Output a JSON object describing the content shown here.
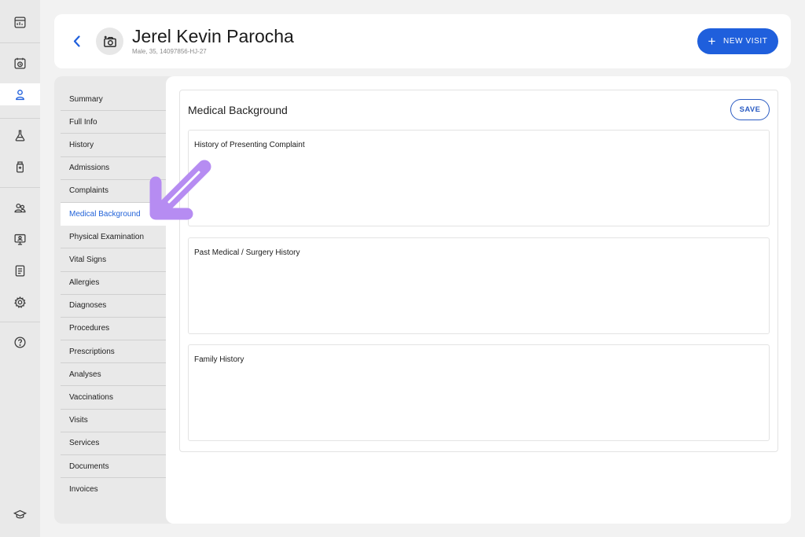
{
  "patient": {
    "name": "Jerel Kevin Parocha",
    "meta": "Male, 35, 14097856-HJ-27"
  },
  "header": {
    "new_visit_label": "NEW VISIT"
  },
  "rail": {
    "items": [
      {
        "icon": "dashboard-icon",
        "active": false
      },
      {
        "icon": "calendar-clock-icon",
        "active": false
      },
      {
        "icon": "patient-user-icon",
        "active": true
      },
      {
        "icon": "lab-flask-icon",
        "active": false
      },
      {
        "icon": "medicine-bottle-icon",
        "active": false
      },
      {
        "icon": "users-group-icon",
        "active": false
      },
      {
        "icon": "monitor-user-icon",
        "active": false
      },
      {
        "icon": "report-list-icon",
        "active": false
      },
      {
        "icon": "settings-gear-icon",
        "active": false
      },
      {
        "icon": "help-circle-icon",
        "active": false
      },
      {
        "icon": "graduation-cap-icon",
        "active": false
      }
    ],
    "accent": "#1f5fdc"
  },
  "sidenav": {
    "items": [
      "Summary",
      "Full Info",
      "History",
      "Admissions",
      "Complaints",
      "Medical Background",
      "Physical Examination",
      "Vital Signs",
      "Allergies",
      "Diagnoses",
      "Procedures",
      "Prescriptions",
      "Analyses",
      "Vaccinations",
      "Visits",
      "Services",
      "Documents",
      "Invoices"
    ],
    "active": "Medical Background"
  },
  "section": {
    "title": "Medical Background",
    "save_label": "SAVE",
    "fields": [
      {
        "label": "History of Presenting Complaint",
        "value": ""
      },
      {
        "label": "Past Medical / Surgery History",
        "value": ""
      },
      {
        "label": "Family History",
        "value": ""
      }
    ]
  },
  "annotation": {
    "arrow_color": "#b68cf2",
    "points_to": "Medical Background"
  },
  "colors": {
    "primary": "#1f5fdc",
    "active_nav_text": "#2263d9"
  }
}
